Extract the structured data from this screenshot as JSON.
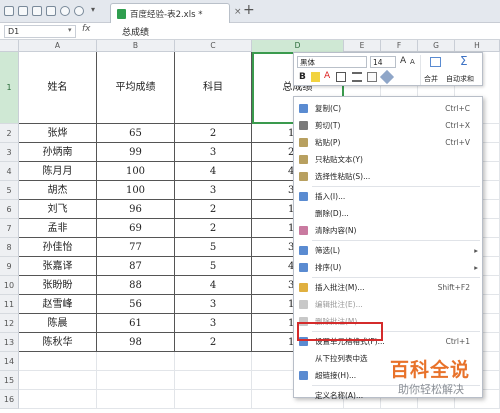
{
  "tab": {
    "filename": "百度经验-表2.xls *",
    "close": "×",
    "new": "+"
  },
  "formula": {
    "cell_ref": "D1",
    "fx": "fx",
    "value": "总成绩"
  },
  "columns": [
    "A",
    "B",
    "C",
    "D",
    "E",
    "F",
    "G",
    "H"
  ],
  "rows": [
    "1",
    "2",
    "3",
    "4",
    "5",
    "6",
    "7",
    "8",
    "9",
    "10",
    "11",
    "12",
    "13",
    "14",
    "15",
    "16"
  ],
  "headers": [
    "姓名",
    "平均成绩",
    "科目",
    "总成绩"
  ],
  "data": [
    [
      "张烨",
      "65",
      "2",
      "130"
    ],
    [
      "孙炳南",
      "99",
      "3",
      "297"
    ],
    [
      "陈月月",
      "100",
      "4",
      "400"
    ],
    [
      "胡杰",
      "100",
      "3",
      "300"
    ],
    [
      "刘飞",
      "96",
      "2",
      "192"
    ],
    [
      "孟非",
      "69",
      "2",
      "138"
    ],
    [
      "孙佳怡",
      "77",
      "5",
      "385"
    ],
    [
      "张嘉译",
      "87",
      "5",
      "435"
    ],
    [
      "张盼盼",
      "88",
      "4",
      "352"
    ],
    [
      "赵雪峰",
      "56",
      "3",
      "168"
    ],
    [
      "陈晨",
      "61",
      "3",
      "183"
    ],
    [
      "陈秋华",
      "98",
      "2",
      "196"
    ]
  ],
  "minitoolbar": {
    "font": "黑体",
    "size": "14",
    "merge": "合并",
    "autosum": "自动求和"
  },
  "menu": [
    {
      "label": "复制(C)",
      "shortcut": "Ctrl+C",
      "icon": "copy-icon",
      "color": "#5a8bd1"
    },
    {
      "label": "剪切(T)",
      "shortcut": "Ctrl+X",
      "icon": "scissors-icon",
      "color": "#7a7a7a"
    },
    {
      "label": "粘贴(P)",
      "shortcut": "Ctrl+V",
      "icon": "paste-icon",
      "color": "#b8a060"
    },
    {
      "label": "只粘贴文本(Y)",
      "shortcut": "",
      "icon": "paste-text-icon",
      "color": "#b8a060"
    },
    {
      "label": "选择性粘贴(S)...",
      "shortcut": "",
      "icon": "paste-special-icon",
      "color": "#b8a060"
    },
    {
      "sep": true
    },
    {
      "label": "插入(I)...",
      "shortcut": "",
      "icon": "insert-icon",
      "color": "#5a8bd1"
    },
    {
      "label": "删除(D)...",
      "shortcut": "",
      "icon": "",
      "color": ""
    },
    {
      "label": "清除内容(N)",
      "shortcut": "",
      "icon": "eraser-icon",
      "color": "#c97aa0"
    },
    {
      "sep": true
    },
    {
      "label": "筛选(L)",
      "shortcut": "",
      "icon": "filter-icon",
      "color": "#5a8bd1",
      "arrow": true
    },
    {
      "label": "排序(U)",
      "shortcut": "",
      "icon": "sort-icon",
      "color": "#5a8bd1",
      "arrow": true
    },
    {
      "sep": true
    },
    {
      "label": "插入批注(M)...",
      "shortcut": "Shift+F2",
      "icon": "comment-icon",
      "color": "#e0b040"
    },
    {
      "label": "编辑批注(E)...",
      "shortcut": "",
      "icon": "edit-comment-icon",
      "color": "#c8c8c8",
      "disabled": true
    },
    {
      "label": "删除批注(M)",
      "shortcut": "",
      "icon": "delete-comment-icon",
      "color": "#c8c8c8",
      "disabled": true
    },
    {
      "sep": true
    },
    {
      "label": "设置单元格格式(F)...",
      "shortcut": "Ctrl+1",
      "icon": "format-cells-icon",
      "color": "#5a8bd1",
      "active": true
    },
    {
      "label": "从下拉列表中选",
      "shortcut": "",
      "icon": "",
      "color": ""
    },
    {
      "label": "超链接(H)...",
      "shortcut": "",
      "icon": "hyperlink-icon",
      "color": "#5a8bd1"
    },
    {
      "sep": true
    },
    {
      "label": "定义名称(A)...",
      "shortcut": "",
      "icon": "",
      "color": ""
    }
  ],
  "watermark": {
    "main": "百科全说",
    "sub": "助你轻松解决"
  }
}
